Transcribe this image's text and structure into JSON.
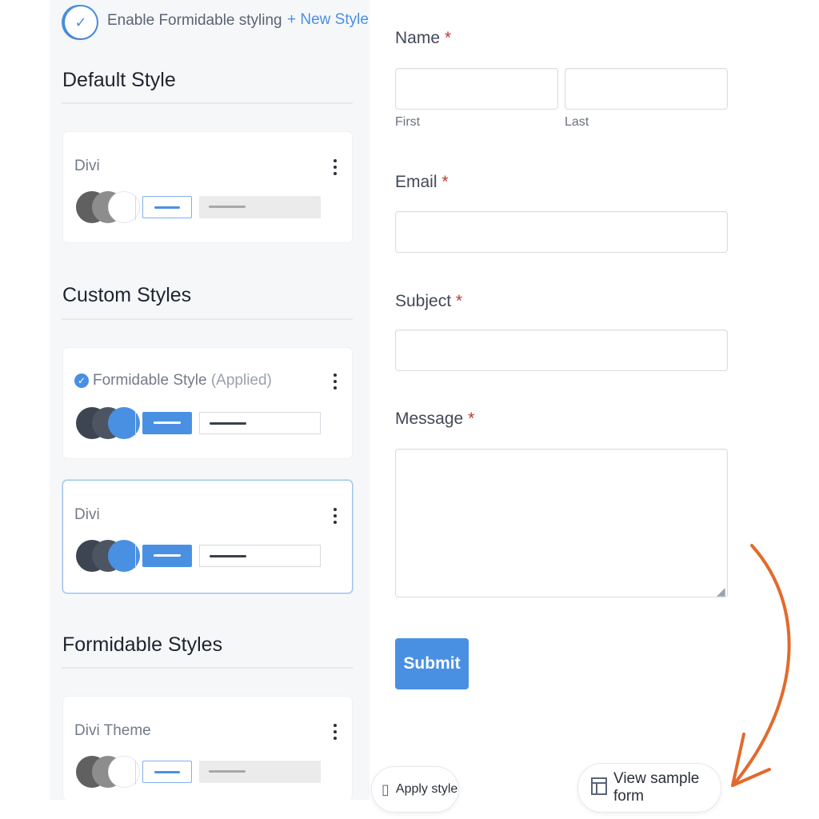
{
  "sidebar": {
    "toggle_label": "Enable Formidable styling",
    "new_style_label": "+ New Style",
    "default_section_title": "Default Style",
    "custom_section_title": "Custom Styles",
    "formidable_section_title": "Formidable Styles",
    "default_card": {
      "name": "Divi"
    },
    "custom_cards": [
      {
        "name": "Formidable Style",
        "status": "(Applied)"
      },
      {
        "name": "Divi"
      }
    ],
    "formidable_card": {
      "name": "Divi Theme"
    }
  },
  "form": {
    "name_label": "Name",
    "first_label": "First",
    "last_label": "Last",
    "email_label": "Email",
    "subject_label": "Subject",
    "message_label": "Message",
    "required_marker": "*",
    "submit_label": "Submit"
  },
  "actions": {
    "apply_style_label": "Apply style",
    "view_sample_label": "View sample form"
  },
  "colors": {
    "accent": "#4a90e2",
    "arrow": "#e26a2c"
  }
}
